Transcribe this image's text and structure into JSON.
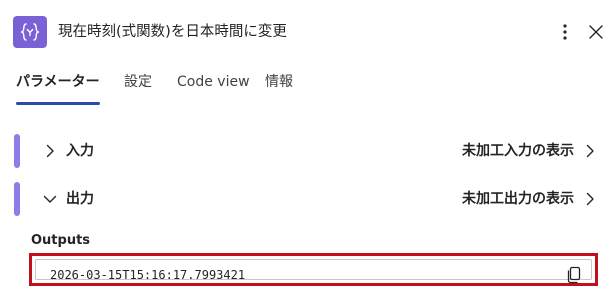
{
  "header": {
    "title": "現在時刻(式関数)を日本時間に変更",
    "icon": "expression-icon",
    "accent_color": "#7b61d6"
  },
  "tabs": [
    {
      "label": "パラメーター",
      "active": true
    },
    {
      "label": "設定",
      "active": false
    },
    {
      "label": "Code view",
      "active": false
    },
    {
      "label": "情報",
      "active": false
    }
  ],
  "sections": {
    "input": {
      "label": "入力",
      "raw_link": "未加工入力の表示",
      "expanded": false
    },
    "output": {
      "label": "出力",
      "raw_link": "未加工出力の表示",
      "expanded": true
    }
  },
  "outputs": {
    "label": "Outputs",
    "value": "2026-03-15T15:16:17.7993421",
    "highlight_color": "#c0101e"
  }
}
